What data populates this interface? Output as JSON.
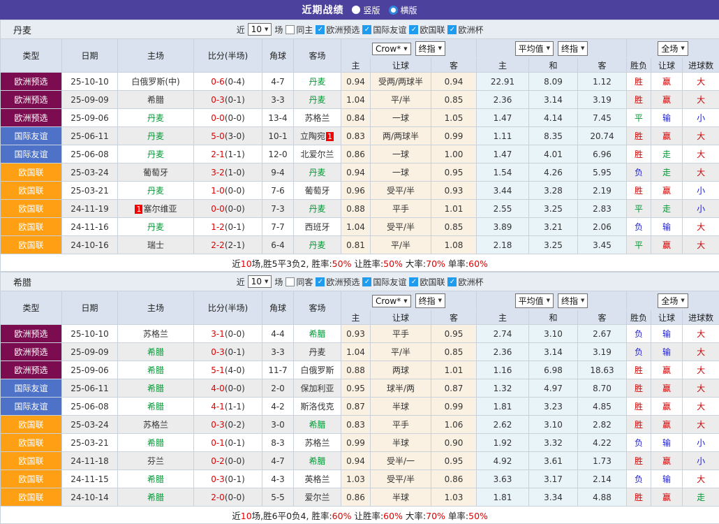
{
  "titlebar": {
    "title": "近期战绩",
    "vertical": "竖版",
    "horizontal": "横版",
    "selected": "横版"
  },
  "filter": {
    "near": "近",
    "count": "10",
    "games": "场",
    "leagues": [
      "欧洲预选",
      "国际友谊",
      "欧国联",
      "欧洲杯"
    ]
  },
  "table_header": {
    "cols": [
      "类型",
      "日期",
      "主场",
      "比分(半场)",
      "角球",
      "客场"
    ],
    "odds_dd": "Crow*",
    "odds_dd2": "终指",
    "avg_dd": "平均值",
    "avg_dd2": "终指",
    "full_dd": "全场",
    "sub": [
      "主",
      "让球",
      "客",
      "主",
      "和",
      "客",
      "胜负",
      "让球",
      "进球数"
    ]
  },
  "league_colors": {
    "欧洲预选": "#7b0c4f",
    "国际友谊": "#4e72c8",
    "欧国联": "#ffa014"
  },
  "result_colors": {
    "red": "#d40000",
    "green": "#009933",
    "blue": "#2222cc"
  },
  "tables": [
    {
      "team": "丹麦",
      "same_label": "同主",
      "rows": [
        {
          "league": "欧洲预选",
          "date": "25-10-10",
          "home": {
            "name": "白俄罗斯(中)"
          },
          "score": "0-6",
          "half": "(0-4)",
          "corner": "4-7",
          "away": {
            "name": "丹麦",
            "ref": true
          },
          "odds": [
            "0.94",
            "受两/两球半",
            "0.94"
          ],
          "avg": [
            "22.91",
            "8.09",
            "1.12"
          ],
          "results": [
            {
              "t": "胜",
              "c": "red"
            },
            {
              "t": "赢",
              "c": "red"
            },
            {
              "t": "大",
              "c": "red"
            }
          ]
        },
        {
          "league": "欧洲预选",
          "date": "25-09-09",
          "home": {
            "name": "希腊"
          },
          "score": "0-3",
          "half": "(0-1)",
          "corner": "3-3",
          "away": {
            "name": "丹麦",
            "ref": true
          },
          "odds": [
            "1.04",
            "平/半",
            "0.85"
          ],
          "avg": [
            "2.36",
            "3.14",
            "3.19"
          ],
          "results": [
            {
              "t": "胜",
              "c": "red"
            },
            {
              "t": "赢",
              "c": "red"
            },
            {
              "t": "大",
              "c": "red"
            }
          ]
        },
        {
          "league": "欧洲预选",
          "date": "25-09-06",
          "home": {
            "name": "丹麦",
            "ref": true
          },
          "score": "0-0",
          "half": "(0-0)",
          "corner": "13-4",
          "away": {
            "name": "苏格兰"
          },
          "odds": [
            "0.84",
            "一球",
            "1.05"
          ],
          "avg": [
            "1.47",
            "4.14",
            "7.45"
          ],
          "results": [
            {
              "t": "平",
              "c": "green"
            },
            {
              "t": "输",
              "c": "blue"
            },
            {
              "t": "小",
              "c": "blue"
            }
          ]
        },
        {
          "league": "国际友谊",
          "date": "25-06-11",
          "home": {
            "name": "丹麦",
            "ref": true
          },
          "score": "5-0",
          "half": "(3-0)",
          "corner": "10-1",
          "away": {
            "name": "立陶宛",
            "badge": "1",
            "badge_pos": "after"
          },
          "odds": [
            "0.83",
            "两/两球半",
            "0.99"
          ],
          "avg": [
            "1.11",
            "8.35",
            "20.74"
          ],
          "results": [
            {
              "t": "胜",
              "c": "red"
            },
            {
              "t": "赢",
              "c": "red"
            },
            {
              "t": "大",
              "c": "red"
            }
          ]
        },
        {
          "league": "国际友谊",
          "date": "25-06-08",
          "home": {
            "name": "丹麦",
            "ref": true
          },
          "score": "2-1",
          "half": "(1-1)",
          "corner": "12-0",
          "away": {
            "name": "北爱尔兰"
          },
          "odds": [
            "0.86",
            "一球",
            "1.00"
          ],
          "avg": [
            "1.47",
            "4.01",
            "6.96"
          ],
          "results": [
            {
              "t": "胜",
              "c": "red"
            },
            {
              "t": "走",
              "c": "green"
            },
            {
              "t": "大",
              "c": "red"
            }
          ]
        },
        {
          "league": "欧国联",
          "date": "25-03-24",
          "home": {
            "name": "葡萄牙"
          },
          "score": "3-2",
          "half": "(1-0)",
          "corner": "9-4",
          "away": {
            "name": "丹麦",
            "ref": true
          },
          "odds": [
            "0.94",
            "一球",
            "0.95"
          ],
          "avg": [
            "1.54",
            "4.26",
            "5.95"
          ],
          "results": [
            {
              "t": "负",
              "c": "blue"
            },
            {
              "t": "走",
              "c": "green"
            },
            {
              "t": "大",
              "c": "red"
            }
          ]
        },
        {
          "league": "欧国联",
          "date": "25-03-21",
          "home": {
            "name": "丹麦",
            "ref": true
          },
          "score": "1-0",
          "half": "(0-0)",
          "corner": "7-6",
          "away": {
            "name": "葡萄牙"
          },
          "odds": [
            "0.96",
            "受平/半",
            "0.93"
          ],
          "avg": [
            "3.44",
            "3.28",
            "2.19"
          ],
          "results": [
            {
              "t": "胜",
              "c": "red"
            },
            {
              "t": "赢",
              "c": "red"
            },
            {
              "t": "小",
              "c": "blue"
            }
          ]
        },
        {
          "league": "欧国联",
          "date": "24-11-19",
          "home": {
            "name": "塞尔维亚",
            "badge": "1",
            "badge_pos": "before"
          },
          "score": "0-0",
          "half": "(0-0)",
          "corner": "7-3",
          "away": {
            "name": "丹麦",
            "ref": true
          },
          "odds": [
            "0.88",
            "平手",
            "1.01"
          ],
          "avg": [
            "2.55",
            "3.25",
            "2.83"
          ],
          "results": [
            {
              "t": "平",
              "c": "green"
            },
            {
              "t": "走",
              "c": "green"
            },
            {
              "t": "小",
              "c": "blue"
            }
          ]
        },
        {
          "league": "欧国联",
          "date": "24-11-16",
          "home": {
            "name": "丹麦",
            "ref": true
          },
          "score": "1-2",
          "half": "(0-1)",
          "corner": "7-7",
          "away": {
            "name": "西班牙"
          },
          "odds": [
            "1.04",
            "受平/半",
            "0.85"
          ],
          "avg": [
            "3.89",
            "3.21",
            "2.06"
          ],
          "results": [
            {
              "t": "负",
              "c": "blue"
            },
            {
              "t": "输",
              "c": "blue"
            },
            {
              "t": "大",
              "c": "red"
            }
          ]
        },
        {
          "league": "欧国联",
          "date": "24-10-16",
          "home": {
            "name": "瑞士"
          },
          "score": "2-2",
          "half": "(2-1)",
          "corner": "6-4",
          "away": {
            "name": "丹麦",
            "ref": true
          },
          "odds": [
            "0.81",
            "平/半",
            "1.08"
          ],
          "avg": [
            "2.18",
            "3.25",
            "3.45"
          ],
          "results": [
            {
              "t": "平",
              "c": "green"
            },
            {
              "t": "赢",
              "c": "red"
            },
            {
              "t": "大",
              "c": "red"
            }
          ]
        }
      ],
      "summary": [
        {
          "t": "近"
        },
        {
          "t": "10",
          "r": true
        },
        {
          "t": "场,胜5平3负2, 胜率:"
        },
        {
          "t": "50%",
          "r": true
        },
        {
          "t": " 让胜率:"
        },
        {
          "t": "50%",
          "r": true
        },
        {
          "t": " 大率:"
        },
        {
          "t": "70%",
          "r": true
        },
        {
          "t": " 单率:"
        },
        {
          "t": "60%",
          "r": true
        }
      ]
    },
    {
      "team": "希腊",
      "same_label": "同客",
      "rows": [
        {
          "league": "欧洲预选",
          "date": "25-10-10",
          "home": {
            "name": "苏格兰"
          },
          "score": "3-1",
          "half": "(0-0)",
          "corner": "4-4",
          "away": {
            "name": "希腊",
            "ref": true
          },
          "odds": [
            "0.93",
            "平手",
            "0.95"
          ],
          "avg": [
            "2.74",
            "3.10",
            "2.67"
          ],
          "results": [
            {
              "t": "负",
              "c": "blue"
            },
            {
              "t": "输",
              "c": "blue"
            },
            {
              "t": "大",
              "c": "red"
            }
          ]
        },
        {
          "league": "欧洲预选",
          "date": "25-09-09",
          "home": {
            "name": "希腊",
            "ref": true
          },
          "score": "0-3",
          "half": "(0-1)",
          "corner": "3-3",
          "away": {
            "name": "丹麦"
          },
          "odds": [
            "1.04",
            "平/半",
            "0.85"
          ],
          "avg": [
            "2.36",
            "3.14",
            "3.19"
          ],
          "results": [
            {
              "t": "负",
              "c": "blue"
            },
            {
              "t": "输",
              "c": "blue"
            },
            {
              "t": "大",
              "c": "red"
            }
          ]
        },
        {
          "league": "欧洲预选",
          "date": "25-09-06",
          "home": {
            "name": "希腊",
            "ref": true
          },
          "score": "5-1",
          "half": "(4-0)",
          "corner": "11-7",
          "away": {
            "name": "白俄罗斯"
          },
          "odds": [
            "0.88",
            "两球",
            "1.01"
          ],
          "avg": [
            "1.16",
            "6.98",
            "18.63"
          ],
          "results": [
            {
              "t": "胜",
              "c": "red"
            },
            {
              "t": "赢",
              "c": "red"
            },
            {
              "t": "大",
              "c": "red"
            }
          ]
        },
        {
          "league": "国际友谊",
          "date": "25-06-11",
          "home": {
            "name": "希腊",
            "ref": true
          },
          "score": "4-0",
          "half": "(0-0)",
          "corner": "2-0",
          "away": {
            "name": "保加利亚"
          },
          "odds": [
            "0.95",
            "球半/两",
            "0.87"
          ],
          "avg": [
            "1.32",
            "4.97",
            "8.70"
          ],
          "results": [
            {
              "t": "胜",
              "c": "red"
            },
            {
              "t": "赢",
              "c": "red"
            },
            {
              "t": "大",
              "c": "red"
            }
          ]
        },
        {
          "league": "国际友谊",
          "date": "25-06-08",
          "home": {
            "name": "希腊",
            "ref": true
          },
          "score": "4-1",
          "half": "(1-1)",
          "corner": "4-2",
          "away": {
            "name": "斯洛伐克"
          },
          "odds": [
            "0.87",
            "半球",
            "0.99"
          ],
          "avg": [
            "1.81",
            "3.23",
            "4.85"
          ],
          "results": [
            {
              "t": "胜",
              "c": "red"
            },
            {
              "t": "赢",
              "c": "red"
            },
            {
              "t": "大",
              "c": "red"
            }
          ]
        },
        {
          "league": "欧国联",
          "date": "25-03-24",
          "home": {
            "name": "苏格兰"
          },
          "score": "0-3",
          "half": "(0-2)",
          "corner": "3-0",
          "away": {
            "name": "希腊",
            "ref": true
          },
          "odds": [
            "0.83",
            "平手",
            "1.06"
          ],
          "avg": [
            "2.62",
            "3.10",
            "2.82"
          ],
          "results": [
            {
              "t": "胜",
              "c": "red"
            },
            {
              "t": "赢",
              "c": "red"
            },
            {
              "t": "大",
              "c": "red"
            }
          ]
        },
        {
          "league": "欧国联",
          "date": "25-03-21",
          "home": {
            "name": "希腊",
            "ref": true
          },
          "score": "0-1",
          "half": "(0-1)",
          "corner": "8-3",
          "away": {
            "name": "苏格兰"
          },
          "odds": [
            "0.99",
            "半球",
            "0.90"
          ],
          "avg": [
            "1.92",
            "3.32",
            "4.22"
          ],
          "results": [
            {
              "t": "负",
              "c": "blue"
            },
            {
              "t": "输",
              "c": "blue"
            },
            {
              "t": "小",
              "c": "blue"
            }
          ]
        },
        {
          "league": "欧国联",
          "date": "24-11-18",
          "home": {
            "name": "芬兰"
          },
          "score": "0-2",
          "half": "(0-0)",
          "corner": "4-7",
          "away": {
            "name": "希腊",
            "ref": true
          },
          "odds": [
            "0.94",
            "受半/一",
            "0.95"
          ],
          "avg": [
            "4.92",
            "3.61",
            "1.73"
          ],
          "results": [
            {
              "t": "胜",
              "c": "red"
            },
            {
              "t": "赢",
              "c": "red"
            },
            {
              "t": "小",
              "c": "blue"
            }
          ]
        },
        {
          "league": "欧国联",
          "date": "24-11-15",
          "home": {
            "name": "希腊",
            "ref": true
          },
          "score": "0-3",
          "half": "(0-1)",
          "corner": "4-3",
          "away": {
            "name": "英格兰"
          },
          "odds": [
            "1.03",
            "受平/半",
            "0.86"
          ],
          "avg": [
            "3.63",
            "3.17",
            "2.14"
          ],
          "results": [
            {
              "t": "负",
              "c": "blue"
            },
            {
              "t": "输",
              "c": "blue"
            },
            {
              "t": "大",
              "c": "red"
            }
          ]
        },
        {
          "league": "欧国联",
          "date": "24-10-14",
          "home": {
            "name": "希腊",
            "ref": true
          },
          "score": "2-0",
          "half": "(0-0)",
          "corner": "5-5",
          "away": {
            "name": "爱尔兰"
          },
          "odds": [
            "0.86",
            "半球",
            "1.03"
          ],
          "avg": [
            "1.81",
            "3.34",
            "4.88"
          ],
          "results": [
            {
              "t": "胜",
              "c": "red"
            },
            {
              "t": "赢",
              "c": "red"
            },
            {
              "t": "走",
              "c": "green"
            }
          ]
        }
      ],
      "summary": [
        {
          "t": "近"
        },
        {
          "t": "10",
          "r": true
        },
        {
          "t": "场,胜6平0负4, 胜率:"
        },
        {
          "t": "60%",
          "r": true
        },
        {
          "t": " 让胜率:"
        },
        {
          "t": "60%",
          "r": true
        },
        {
          "t": " 大率:"
        },
        {
          "t": "70%",
          "r": true
        },
        {
          "t": " 单率:"
        },
        {
          "t": "50%",
          "r": true
        }
      ]
    }
  ]
}
